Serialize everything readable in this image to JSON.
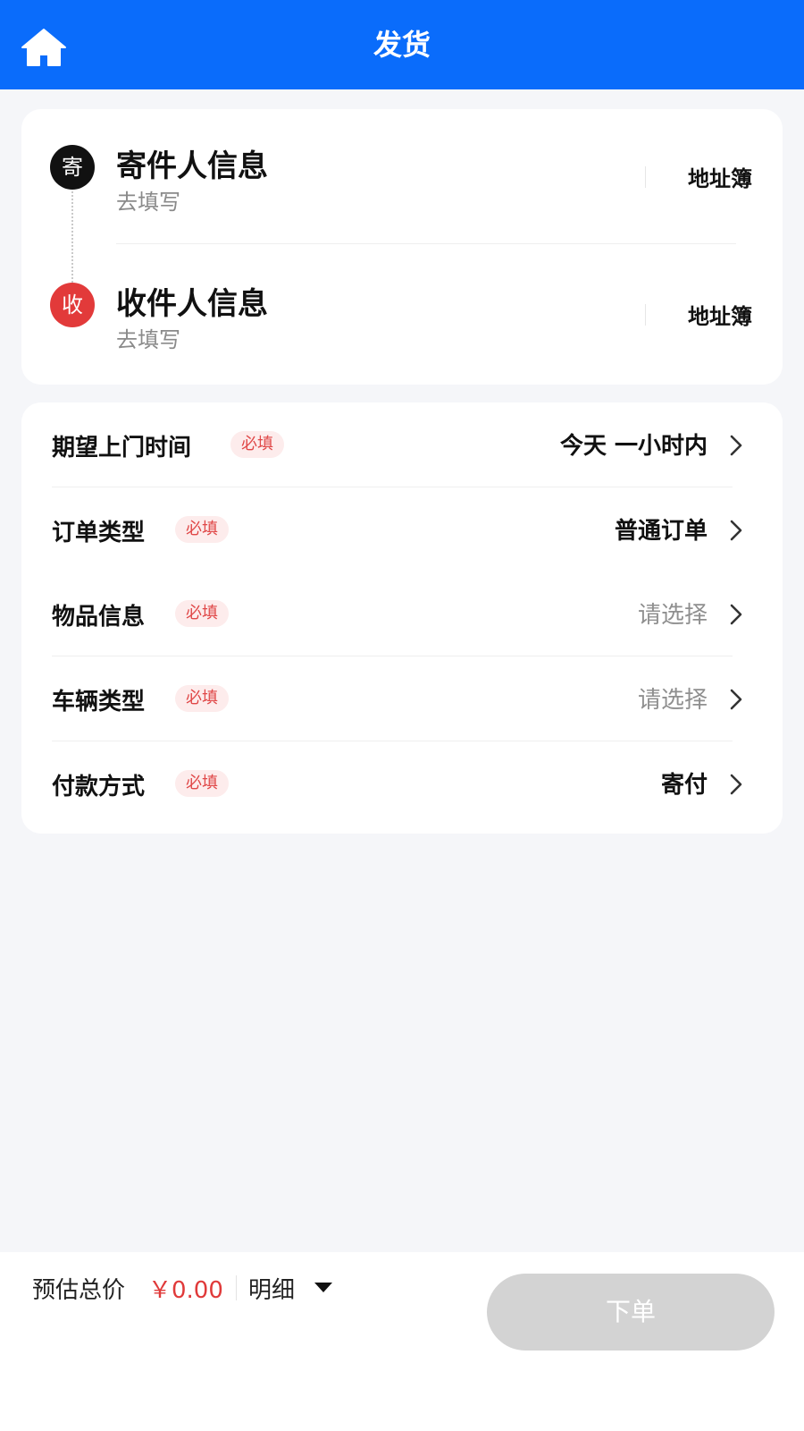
{
  "header": {
    "title": "发货",
    "home_icon": "home-icon",
    "bg_color": "#0a6cfb"
  },
  "contacts": {
    "sender": {
      "badge": "寄",
      "title": "寄件人信息",
      "subtitle": "去填写",
      "address_book": "地址簿"
    },
    "receiver": {
      "badge": "收",
      "title": "收件人信息",
      "subtitle": "去填写",
      "address_book": "地址簿"
    }
  },
  "options": [
    {
      "label": "期望上门时间",
      "required": "必填",
      "value": "今天 一小时内",
      "state": "filled"
    },
    {
      "label": "订单类型",
      "required": "必填",
      "value": "普通订单",
      "state": "filled"
    },
    {
      "label": "物品信息",
      "required": "必填",
      "value": "请选择",
      "state": "empty"
    },
    {
      "label": "车辆类型",
      "required": "必填",
      "value": "请选择",
      "state": "empty"
    },
    {
      "label": "付款方式",
      "required": "必填",
      "value": "寄付",
      "state": "filled"
    }
  ],
  "footer": {
    "price_label": "预估总价",
    "price_value": "￥0.00",
    "detail_label": "明细",
    "submit_label": "下单"
  },
  "colors": {
    "accent": "#0a6cfb",
    "required_text": "#e04848",
    "price": "#e03a3a",
    "submit_disabled": "#d3d3d3"
  }
}
